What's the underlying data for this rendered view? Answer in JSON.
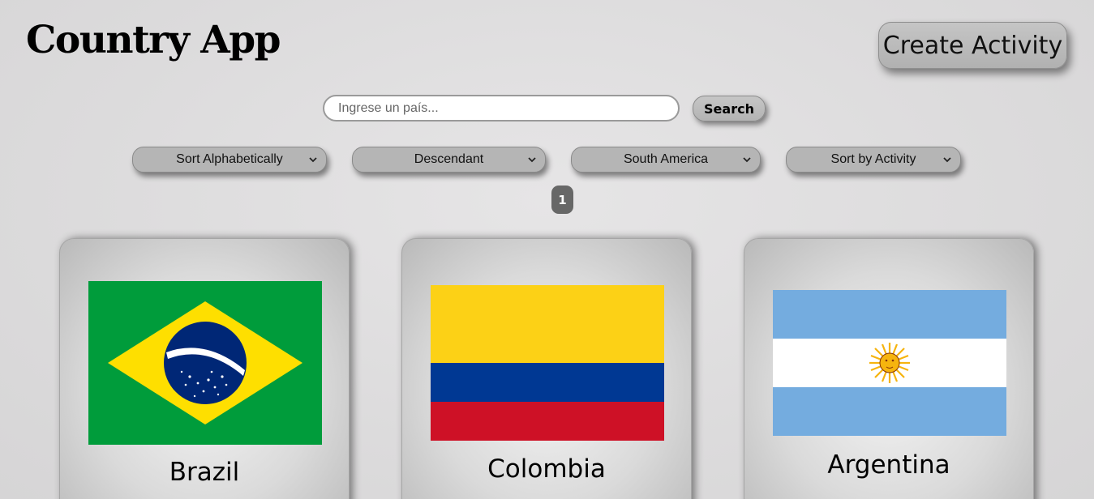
{
  "header": {
    "title": "Country App",
    "create_activity_label": "Create Activity"
  },
  "search": {
    "placeholder": "Ingrese un país...",
    "value": "",
    "button_label": "Search"
  },
  "filters": {
    "sort_alpha": "Sort Alphabetically",
    "order": "Descendant",
    "continent": "South America",
    "activity": "Sort by Activity"
  },
  "pagination": {
    "current_page": "1"
  },
  "countries": [
    {
      "name": "Brazil",
      "flag_icon": "brazil-flag"
    },
    {
      "name": "Colombia",
      "flag_icon": "colombia-flag"
    },
    {
      "name": "Argentina",
      "flag_icon": "argentina-flag"
    }
  ],
  "colors": {
    "brazil_green": "#009c3b",
    "brazil_yellow": "#fedf00",
    "brazil_blue": "#002776",
    "colombia_yellow": "#fcd116",
    "colombia_blue": "#003893",
    "colombia_red": "#ce1126",
    "argentina_blue": "#74acdf",
    "argentina_sun": "#f6b40e",
    "badge": "#676767"
  }
}
